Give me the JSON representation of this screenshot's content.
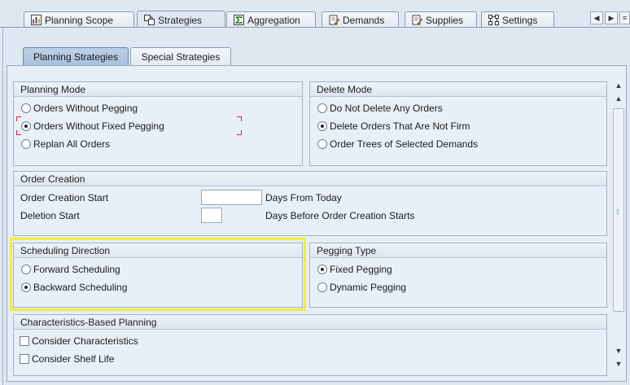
{
  "top_tabs": [
    {
      "label": "Planning Scope",
      "icon": "bar-chart-icon",
      "active": false
    },
    {
      "label": "Strategies",
      "icon": "strategy-icon",
      "active": true
    },
    {
      "label": "Aggregation",
      "icon": "sum-icon",
      "active": false
    },
    {
      "label": "Demands",
      "icon": "document-edit-icon",
      "active": false
    },
    {
      "label": "Supplies",
      "icon": "document-edit-icon",
      "active": false
    },
    {
      "label": "Settings",
      "icon": "settings-tree-icon",
      "active": false
    }
  ],
  "sub_tabs": [
    {
      "label": "Planning Strategies",
      "active": true
    },
    {
      "label": "Special Strategies",
      "active": false
    }
  ],
  "planning_mode": {
    "title": "Planning Mode",
    "options": [
      "Orders Without Pegging",
      "Orders Without Fixed Pegging",
      "Replan All Orders"
    ],
    "selected": 1
  },
  "delete_mode": {
    "title": "Delete Mode",
    "options": [
      "Do Not Delete Any Orders",
      "Delete Orders That Are Not Firm",
      "Order Trees of Selected Demands"
    ],
    "selected": 1
  },
  "order_creation": {
    "title": "Order Creation",
    "start_label": "Order Creation Start",
    "start_value": "",
    "start_unit": "Days From Today",
    "deletion_label": "Deletion Start",
    "deletion_value": "",
    "deletion_unit": "Days Before Order Creation Starts"
  },
  "scheduling_direction": {
    "title": "Scheduling Direction",
    "options": [
      "Forward Scheduling",
      "Backward Scheduling"
    ],
    "selected": 1
  },
  "pegging_type": {
    "title": "Pegging Type",
    "options": [
      "Fixed Pegging",
      "Dynamic Pegging"
    ],
    "selected": 0
  },
  "characteristics": {
    "title": "Characteristics-Based Planning",
    "options": [
      {
        "label": "Consider Characteristics",
        "checked": false
      },
      {
        "label": "Consider Shelf Life",
        "checked": false
      }
    ]
  },
  "colors": {
    "highlight": "#f1ef3a",
    "focus": "#d6262a",
    "active_subtab": "#a9c1dc"
  }
}
